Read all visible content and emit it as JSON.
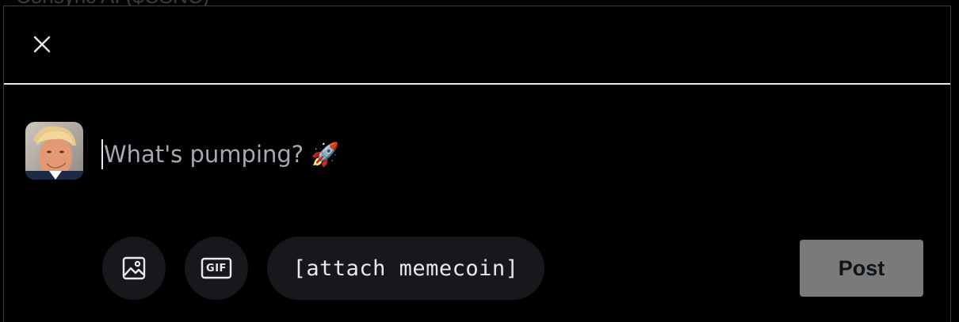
{
  "backdrop": {
    "partial_title": "Consync AI ($CSNC)"
  },
  "header": {
    "close_icon": "close-icon"
  },
  "composer": {
    "placeholder": "What's pumping? 🚀",
    "value": "",
    "avatar_icon": "user-avatar"
  },
  "toolbar": {
    "image_icon": "image-icon",
    "gif_label": "GIF",
    "gif_icon": "gif-icon",
    "attach_memecoin_label": "[attach memecoin]",
    "post_label": "Post"
  },
  "colors": {
    "background": "#000000",
    "divider": "#e7e9ea",
    "tool_button_bg": "#16181c",
    "post_button_bg": "#7a7a7a",
    "placeholder": "#a5a9b4"
  }
}
